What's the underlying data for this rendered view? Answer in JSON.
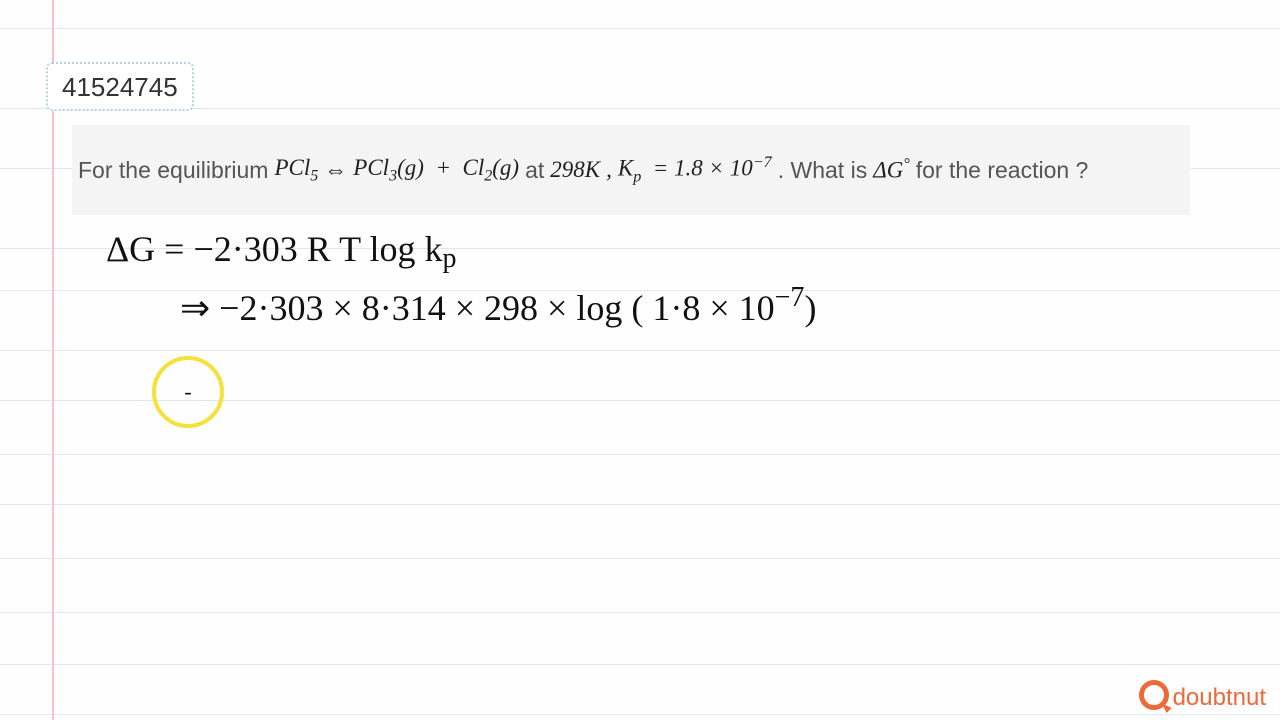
{
  "id_number": "41524745",
  "question": {
    "prefix": "For the equilibrium",
    "reaction_lhs": "PCl",
    "reaction_lhs_sub": "5",
    "arrow": "⇔",
    "reaction_rhs1": "PCl",
    "reaction_rhs1_sub": "3",
    "g1": "(g)",
    "plus": "+",
    "reaction_rhs2": "Cl",
    "reaction_rhs2_sub": "2",
    "g2": "(g)",
    "at": "at",
    "temp": "298K",
    "comma": ",",
    "kp": "K",
    "kp_sub": "p",
    "eq": "= 1.8 × 10",
    "kp_sup": "−7",
    "period": ". What is",
    "dg": "ΔG",
    "dg_sup": "°",
    "end": "for the reaction ?"
  },
  "work": {
    "line1": "ΔG =   −2·303  R T   log  k",
    "line1_sub": "p",
    "line2": "⇒   −2·303 × 8·314 ×  298   ×   log  ( 1·8 × 10",
    "line2_sup": "−7",
    "line2_end": ")",
    "ring_mark": "-"
  },
  "brand": "doubtnut"
}
